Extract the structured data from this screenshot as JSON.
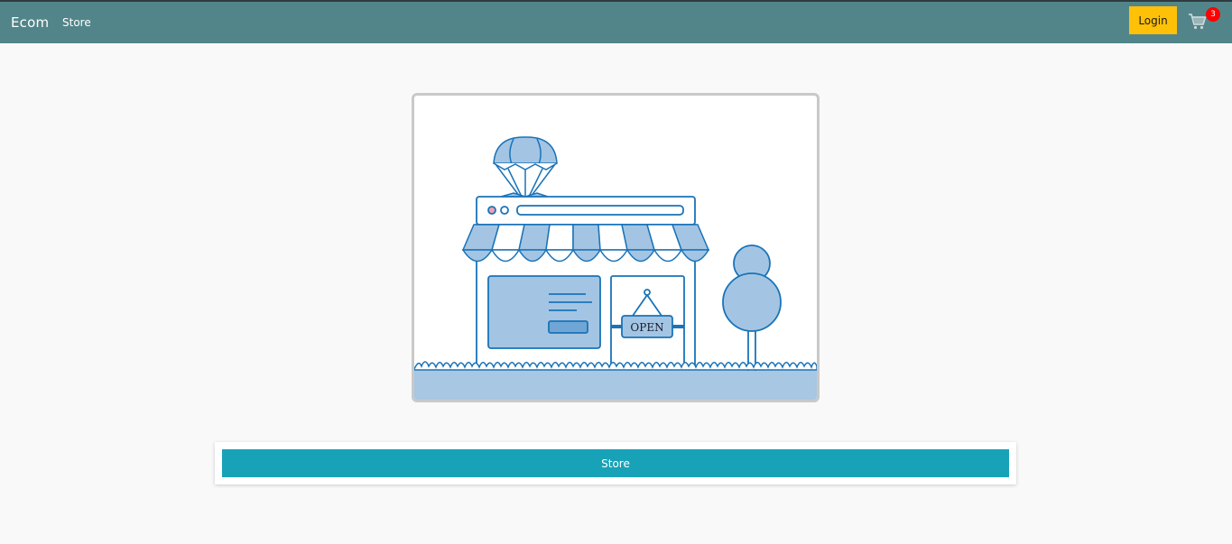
{
  "navbar": {
    "brand": "Ecom",
    "store_link": "Store",
    "login_label": "Login",
    "cart_icon": "shopping-cart-icon",
    "cart_count": "3"
  },
  "hero": {
    "illustration": "storefront-illustration",
    "sign_text": "OPEN"
  },
  "main": {
    "store_button_label": "Store"
  },
  "colors": {
    "navbar": "#528589",
    "login_button": "#ffc107",
    "store_button": "#17a2b8",
    "badge": "#ff0000",
    "illustration_blue": "#1a73b8",
    "illustration_fill": "#a3c5e3"
  }
}
